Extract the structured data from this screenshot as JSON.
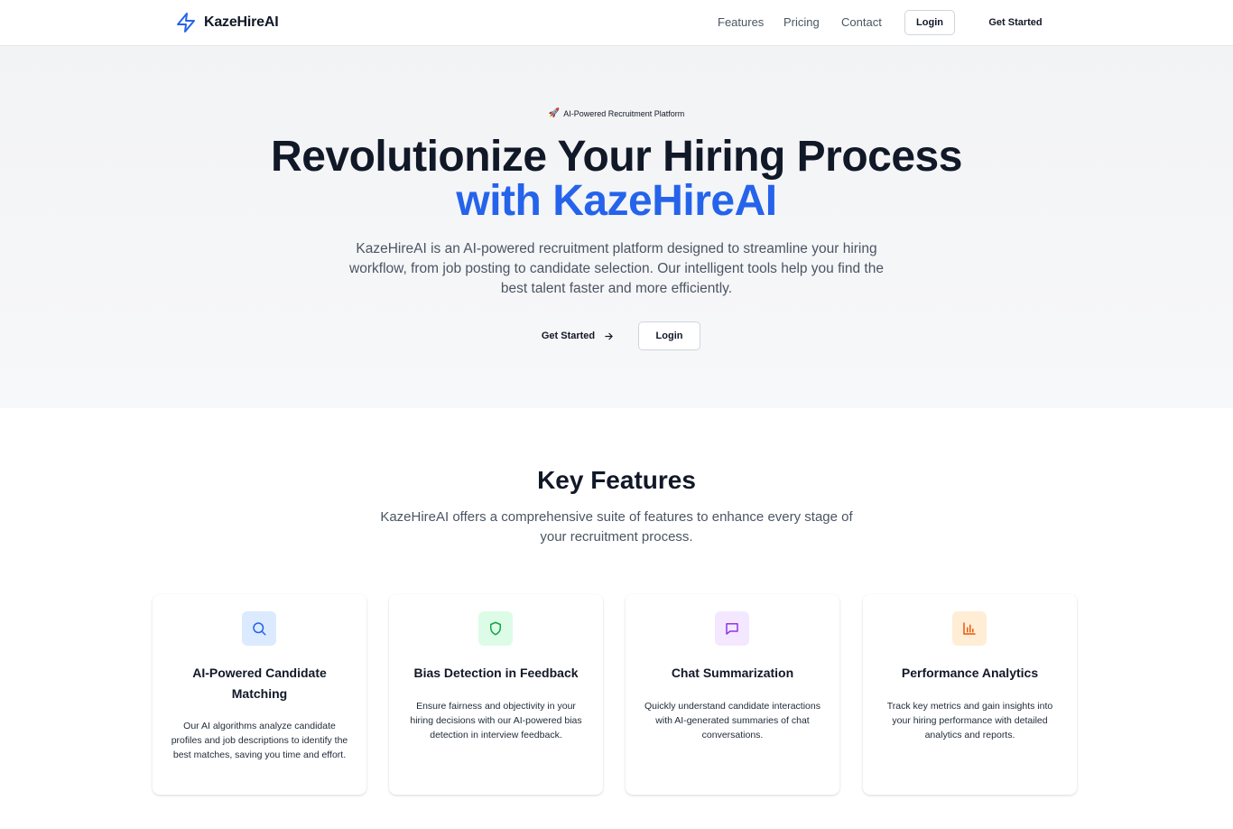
{
  "header": {
    "brand_name": "KazeHireAI",
    "brand_icon": "lightning-bolt-icon",
    "nav": {
      "features": "Features",
      "pricing": "Pricing",
      "contact": "Contact"
    },
    "login_label": "Login",
    "get_started_label": "Get Started"
  },
  "hero": {
    "badge_icon": "rocket-icon",
    "badge_text": "AI-Powered Recruitment Platform",
    "title_line1": "Revolutionize Your Hiring Process",
    "title_line2": "with KazeHireAI",
    "description": "KazeHireAI is an AI-powered recruitment platform designed to streamline your hiring workflow, from job posting to candidate selection. Our intelligent tools help you find the best talent faster and more efficiently.",
    "get_started_label": "Get Started",
    "login_label": "Login"
  },
  "features": {
    "title": "Key Features",
    "description": "KazeHireAI offers a comprehensive suite of features to enhance every stage of your recruitment process.",
    "cards": [
      {
        "icon": "search-icon",
        "icon_color": "#2563eb",
        "icon_bg": "#dbeafe",
        "title": "AI-Powered Candidate Matching",
        "description": "Our AI algorithms analyze candidate profiles and job descriptions to identify the best matches, saving you time and effort."
      },
      {
        "icon": "shield-icon",
        "icon_color": "#16a34a",
        "icon_bg": "#dcfce7",
        "title": "Bias Detection in Feedback",
        "description": "Ensure fairness and objectivity in your hiring decisions with our AI-powered bias detection in interview feedback."
      },
      {
        "icon": "message-square-icon",
        "icon_color": "#9333ea",
        "icon_bg": "#f3e8ff",
        "title": "Chat Summarization",
        "description": "Quickly understand candidate interactions with AI-generated summaries of chat conversations."
      },
      {
        "icon": "bar-chart-icon",
        "icon_color": "#ea580c",
        "icon_bg": "#ffedd5",
        "title": "Performance Analytics",
        "description": "Track key metrics and gain insights into your hiring performance with detailed analytics and reports."
      }
    ]
  },
  "colors": {
    "accent": "#2563eb",
    "text_primary": "#111827",
    "text_muted": "#4b5563"
  }
}
